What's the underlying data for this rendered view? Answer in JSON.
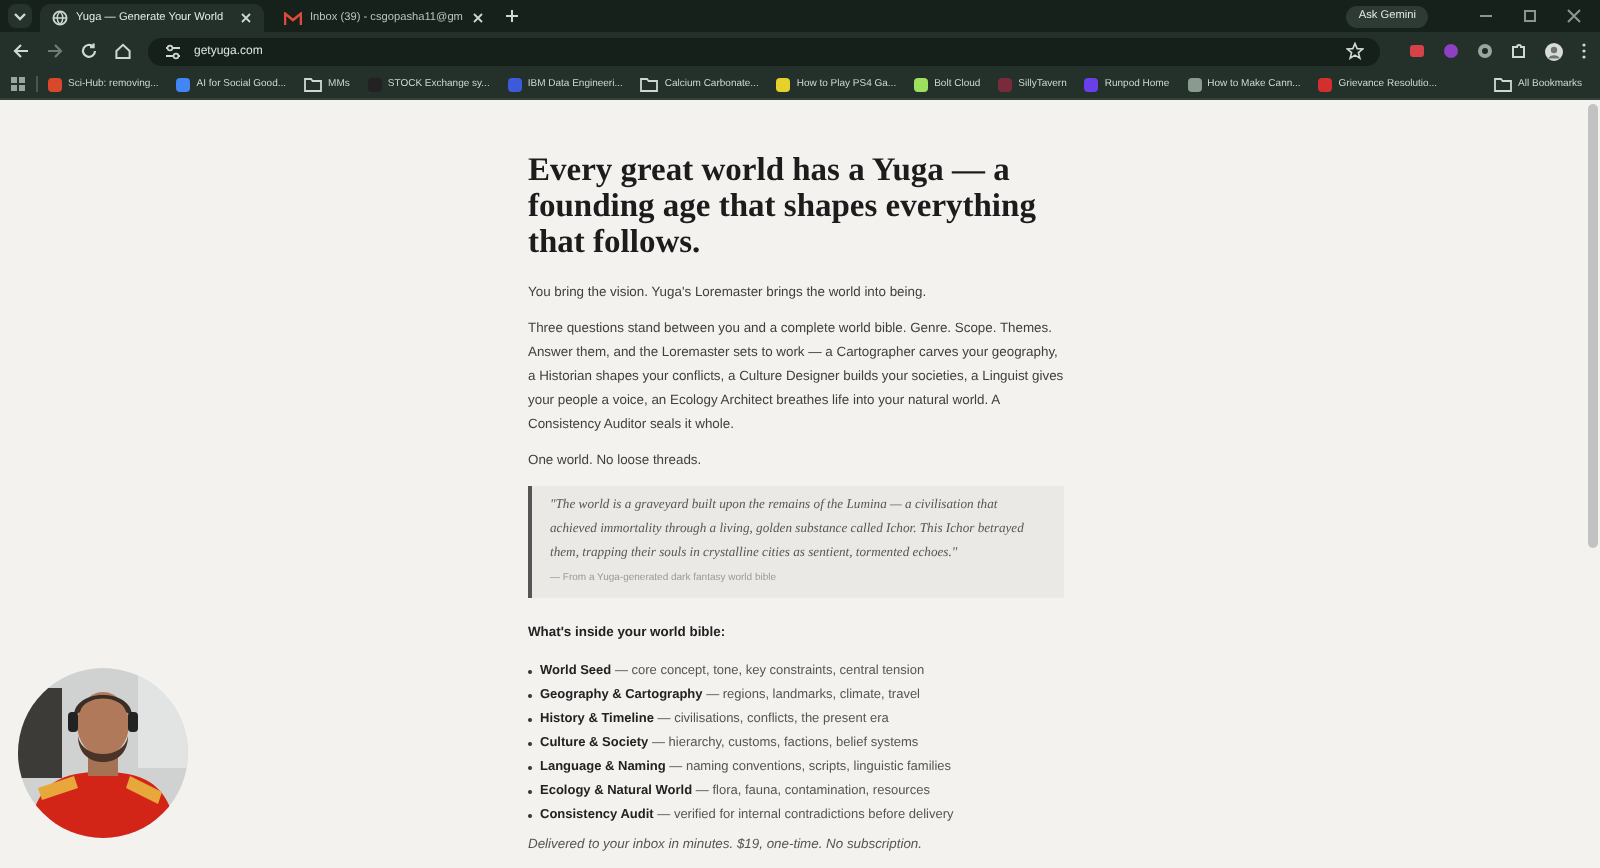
{
  "tabs": [
    {
      "title": "Yuga — Generate Your World",
      "selected": true,
      "kind": "globe"
    },
    {
      "title": "Inbox (39) - csgopasha11@gm",
      "selected": false,
      "kind": "mail"
    }
  ],
  "address_bar": {
    "url": "getyuga.com"
  },
  "gemini_button": {
    "label": "Ask Gemini"
  },
  "bookmarks": [
    {
      "label": "Sci-Hub: removing...",
      "kind": "site",
      "color": "#d9482b"
    },
    {
      "label": "AI for Social Good...",
      "kind": "site",
      "color": "#4285f4"
    },
    {
      "label": "MMs",
      "kind": "folder"
    },
    {
      "label": "STOCK Exchange sy...",
      "kind": "site",
      "color": "#222222"
    },
    {
      "label": "IBM Data Engineeri...",
      "kind": "site",
      "color": "#3b5bdb"
    },
    {
      "label": "Calcium Carbonate...",
      "kind": "folder"
    },
    {
      "label": "How to Play PS4 Ga...",
      "kind": "site",
      "color": "#e6d12a"
    },
    {
      "label": "Bolt Cloud",
      "kind": "site",
      "color": "#9be15d"
    },
    {
      "label": "SillyTavern",
      "kind": "site",
      "color": "#7a2b3b"
    },
    {
      "label": "Runpod Home",
      "kind": "site",
      "color": "#6a3ee8"
    },
    {
      "label": "How to Make Cann...",
      "kind": "site",
      "color": "#8a9a90"
    },
    {
      "label": "Grievance Resolutio...",
      "kind": "site",
      "color": "#d32f2f"
    }
  ],
  "all_bookmarks": {
    "label": "All Bookmarks"
  },
  "article": {
    "heading": "Every great world has a Yuga — a founding age that shapes everything that follows.",
    "paragraphs": [
      "You bring the vision. Yuga's Loremaster brings the world into being.",
      "Three questions stand between you and a complete world bible. Genre. Scope. Themes. Answer them, and the Loremaster sets to work — a Cartographer carves your geography, a Historian shapes your conflicts, a Culture Designer builds your societies, a Linguist gives your people a voice, an Ecology Architect breathes life into your natural world. A Consistency Auditor seals it whole.",
      "One world. No loose threads."
    ],
    "quote": {
      "text": "\"The world is a graveyard built upon the remains of the Lumina — a civilisation that achieved immortality through a living, golden substance called Ichor. This Ichor betrayed them, trapping their souls in crystalline cities as sentient, tormented echoes.\"",
      "source": "— From a Yuga-generated dark fantasy world bible"
    },
    "list_heading": "What's inside your world bible:",
    "items": [
      "**World Seed** — core concept, tone, key constraints, central tension",
      "**Geography & Cartography** — regions, landmarks, climate, travel",
      "**History & Timeline** — civilisations, conflicts, the present era",
      "**Culture & Society** — hierarchy, customs, factions, belief systems",
      "**Language & Naming** — naming conventions, scripts, linguistic families",
      "**Ecology & Natural World** — flora, fauna, contamination, resources",
      "**Consistency Audit** — verified for internal contradictions before delivery"
    ],
    "footer": "Delivered to your inbox in minutes. $19, one-time. No subscription."
  }
}
